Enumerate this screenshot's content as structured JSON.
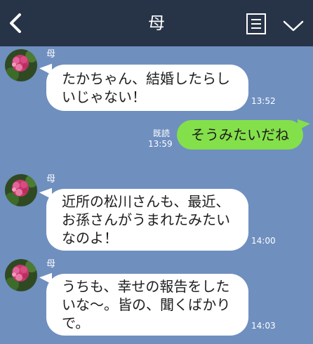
{
  "header": {
    "title": "母",
    "back_icon": "chevron-left-icon",
    "menu_icon": "note-list-icon",
    "collapse_icon": "chevron-down-icon"
  },
  "colors": {
    "header_bg": "#273447",
    "chat_bg": "#6f8fbf",
    "incoming_bubble": "#ffffff",
    "outgoing_bubble": "#84e04a"
  },
  "messages": [
    {
      "direction": "incoming",
      "sender": "母",
      "text": "たかちゃん、結婚したらし\nいじゃない！",
      "time": "13:52"
    },
    {
      "direction": "outgoing",
      "read": "既読",
      "text": "そうみたいだね",
      "time": "13:59"
    },
    {
      "direction": "incoming",
      "sender": "母",
      "text": "近所の松川さんも、最近、\nお孫さんがうまれたみたい\nなのよ！",
      "time": "14:00"
    },
    {
      "direction": "incoming",
      "sender": "母",
      "text": "うちも、幸せの報告をした\nいな〜。皆の、聞くばかり\nで。",
      "time": "14:03"
    }
  ]
}
